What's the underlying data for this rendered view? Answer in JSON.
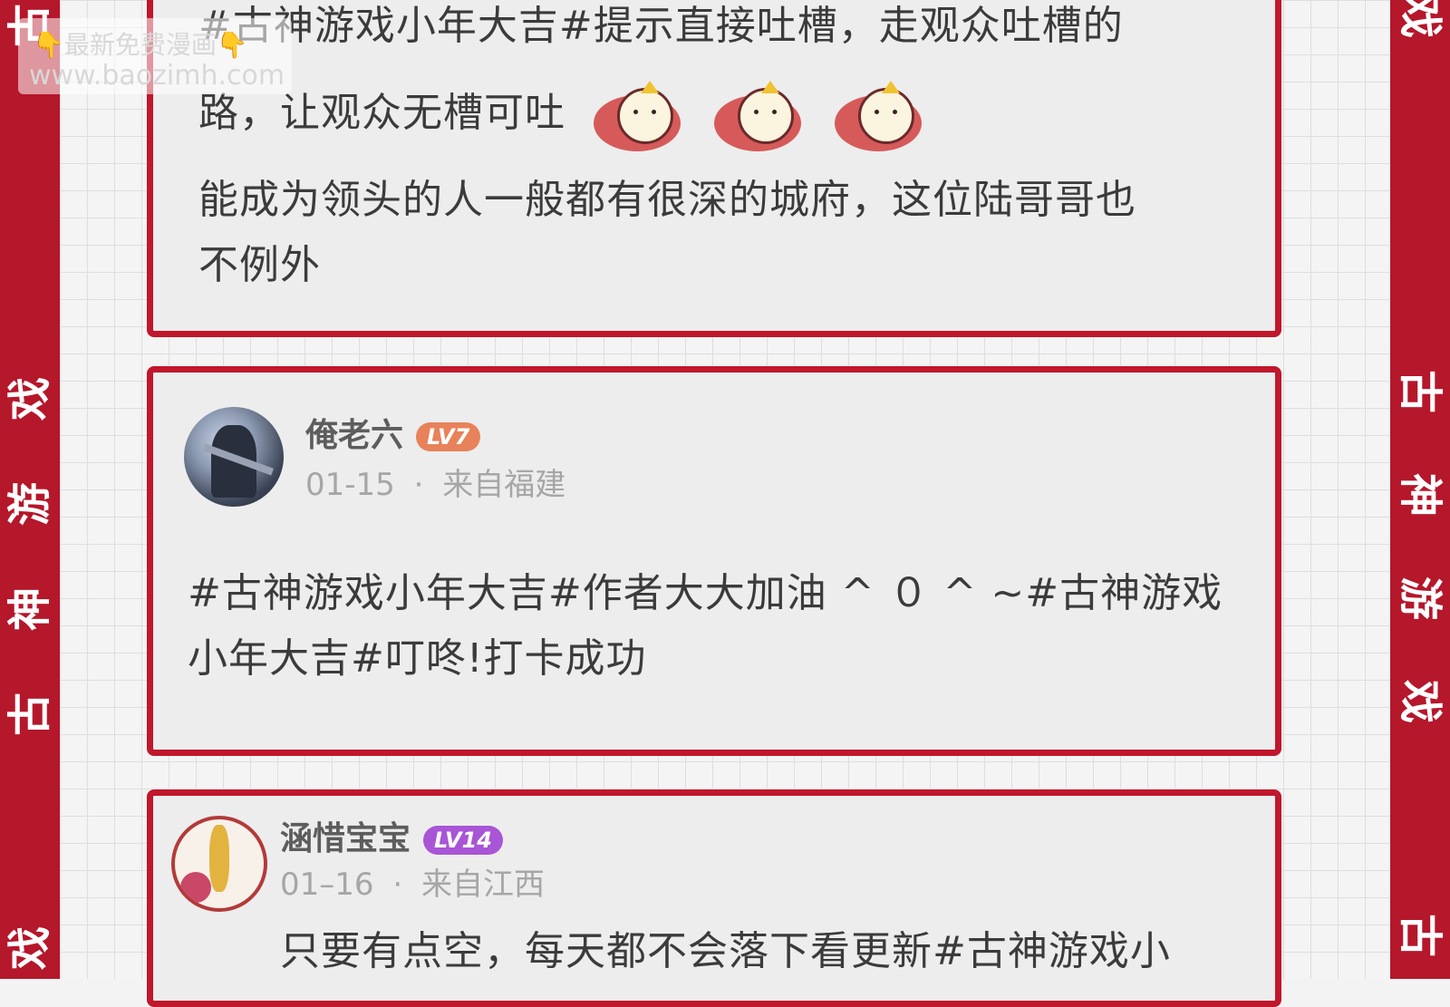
{
  "side_banner": {
    "chars": [
      "古",
      "神",
      "游",
      "戏"
    ]
  },
  "watermark": {
    "line1": "最新免费漫画",
    "line2": "www.baozimh.com",
    "hand_icon": "👇"
  },
  "comments": [
    {
      "text_lines": [
        "#古神游戏小年大吉#提示直接吐槽，走观众吐槽的",
        "路，让观众无槽可吐",
        "能成为领头的人一般都有很深的城府，这位陆哥哥也",
        "不例外"
      ],
      "emoji": [
        "bird-emoji",
        "bird-emoji",
        "bird-emoji"
      ]
    },
    {
      "username": "俺老六",
      "level": "LV7",
      "level_color": "#e8825a",
      "date": "01-15",
      "separator": "·",
      "location": "来自福建",
      "text_lines": [
        "#古神游戏小年大吉#作者大大加油 ^ ０ ^ ~#古神游戏",
        "小年大吉#叮咚!打卡成功"
      ]
    },
    {
      "username": "涵惜宝宝",
      "level": "LV14",
      "level_color": "#a855d6",
      "date": "01–16",
      "separator": "·",
      "location": "来自江西",
      "text_lines": [
        "只要有点空，每天都不会落下看更新#古神游戏小"
      ]
    }
  ],
  "colors": {
    "accent": "#c0172c",
    "strip": "#b5172b"
  }
}
